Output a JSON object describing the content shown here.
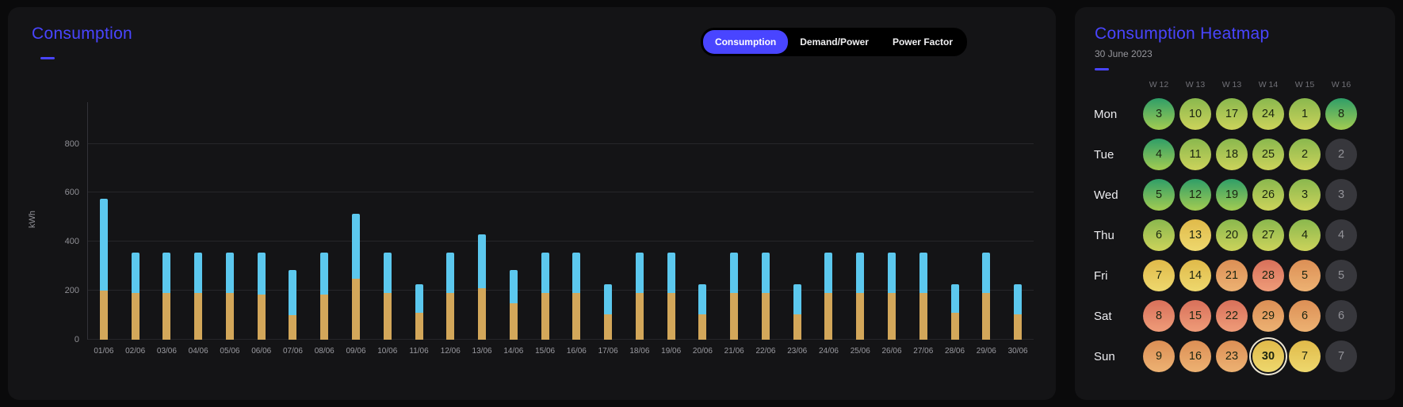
{
  "colors": {
    "page_bg": "#0a0a0b",
    "panel_bg": "#141416",
    "accent": "#4945ff",
    "bar_top": "#5cc8ee",
    "bar_bottom": "#d3a75a",
    "grid_line": "#26262a",
    "axis_text": "#8f8f95",
    "tone_green_a": "#2f9e68",
    "tone_green_b": "#a3cc52",
    "tone_lime_a": "#8ab84e",
    "tone_lime_b": "#ccd35b",
    "tone_yellow_a": "#e0ba4a",
    "tone_yellow_b": "#eed86e",
    "tone_orange_a": "#dc8f55",
    "tone_orange_b": "#edb273",
    "tone_red_a": "#d8705a",
    "tone_red_b": "#ef9c79",
    "tone_gray": "#37373c",
    "cell_text": "#1b2410"
  },
  "tabs": [
    {
      "label": "Consumption",
      "active": true
    },
    {
      "label": "Demand/Power",
      "active": false
    },
    {
      "label": "Power Factor",
      "active": false
    }
  ],
  "chart_data": [
    {
      "type": "bar",
      "stacked": true,
      "title": "Consumption",
      "ylabel": "kWh",
      "ylim": [
        0,
        970
      ],
      "yticks": [
        0,
        200,
        400,
        600,
        800
      ],
      "grid": true,
      "legend": "none",
      "categories": [
        "01/06",
        "02/06",
        "03/06",
        "04/06",
        "05/06",
        "06/06",
        "07/06",
        "08/06",
        "09/06",
        "10/06",
        "11/06",
        "12/06",
        "13/06",
        "14/06",
        "15/06",
        "16/06",
        "17/06",
        "18/06",
        "19/06",
        "20/06",
        "21/06",
        "22/06",
        "23/06",
        "24/06",
        "25/06",
        "26/06",
        "27/06",
        "28/06",
        "29/06",
        "30/06"
      ],
      "series": [
        {
          "name": "bottom",
          "color": "#d3a75a",
          "values": [
            200,
            190,
            190,
            190,
            190,
            185,
            100,
            185,
            250,
            190,
            110,
            190,
            210,
            150,
            190,
            190,
            105,
            190,
            190,
            105,
            190,
            190,
            105,
            190,
            190,
            190,
            190,
            110,
            190,
            105
          ]
        },
        {
          "name": "top",
          "color": "#5cc8ee",
          "values": [
            375,
            165,
            165,
            165,
            165,
            170,
            185,
            170,
            265,
            165,
            115,
            165,
            220,
            135,
            165,
            165,
            120,
            165,
            165,
            120,
            165,
            165,
            120,
            165,
            165,
            165,
            165,
            115,
            165,
            120
          ]
        }
      ]
    },
    {
      "type": "heatmap",
      "title": "Consumption Heatmap",
      "subtitle": "30 June 2023",
      "week_labels": [
        "W 12",
        "W 13",
        "W 13",
        "W 14",
        "W 15",
        "W 16"
      ],
      "rows": [
        {
          "label": "Mon",
          "cells": [
            {
              "day": "3",
              "tone": "green"
            },
            {
              "day": "10",
              "tone": "lime"
            },
            {
              "day": "17",
              "tone": "lime"
            },
            {
              "day": "24",
              "tone": "lime"
            },
            {
              "day": "1",
              "tone": "lime"
            },
            {
              "day": "8",
              "tone": "green"
            }
          ]
        },
        {
          "label": "Tue",
          "cells": [
            {
              "day": "4",
              "tone": "green"
            },
            {
              "day": "11",
              "tone": "lime"
            },
            {
              "day": "18",
              "tone": "lime"
            },
            {
              "day": "25",
              "tone": "lime"
            },
            {
              "day": "2",
              "tone": "lime"
            },
            {
              "day": "2",
              "tone": "gray"
            }
          ]
        },
        {
          "label": "Wed",
          "cells": [
            {
              "day": "5",
              "tone": "green"
            },
            {
              "day": "12",
              "tone": "green"
            },
            {
              "day": "19",
              "tone": "green"
            },
            {
              "day": "26",
              "tone": "lime"
            },
            {
              "day": "3",
              "tone": "lime"
            },
            {
              "day": "3",
              "tone": "gray"
            }
          ]
        },
        {
          "label": "Thu",
          "cells": [
            {
              "day": "6",
              "tone": "lime"
            },
            {
              "day": "13",
              "tone": "yellow"
            },
            {
              "day": "20",
              "tone": "lime"
            },
            {
              "day": "27",
              "tone": "lime"
            },
            {
              "day": "4",
              "tone": "lime"
            },
            {
              "day": "4",
              "tone": "gray"
            }
          ]
        },
        {
          "label": "Fri",
          "cells": [
            {
              "day": "7",
              "tone": "yellow"
            },
            {
              "day": "14",
              "tone": "yellow"
            },
            {
              "day": "21",
              "tone": "orange"
            },
            {
              "day": "28",
              "tone": "red"
            },
            {
              "day": "5",
              "tone": "orange"
            },
            {
              "day": "5",
              "tone": "gray"
            }
          ]
        },
        {
          "label": "Sat",
          "cells": [
            {
              "day": "8",
              "tone": "red"
            },
            {
              "day": "15",
              "tone": "red"
            },
            {
              "day": "22",
              "tone": "red"
            },
            {
              "day": "29",
              "tone": "orange"
            },
            {
              "day": "6",
              "tone": "orange"
            },
            {
              "day": "6",
              "tone": "gray"
            }
          ]
        },
        {
          "label": "Sun",
          "cells": [
            {
              "day": "9",
              "tone": "orange"
            },
            {
              "day": "16",
              "tone": "orange"
            },
            {
              "day": "23",
              "tone": "orange"
            },
            {
              "day": "30",
              "tone": "yellow",
              "selected": true
            },
            {
              "day": "7",
              "tone": "yellow"
            },
            {
              "day": "7",
              "tone": "gray"
            }
          ]
        }
      ]
    }
  ]
}
